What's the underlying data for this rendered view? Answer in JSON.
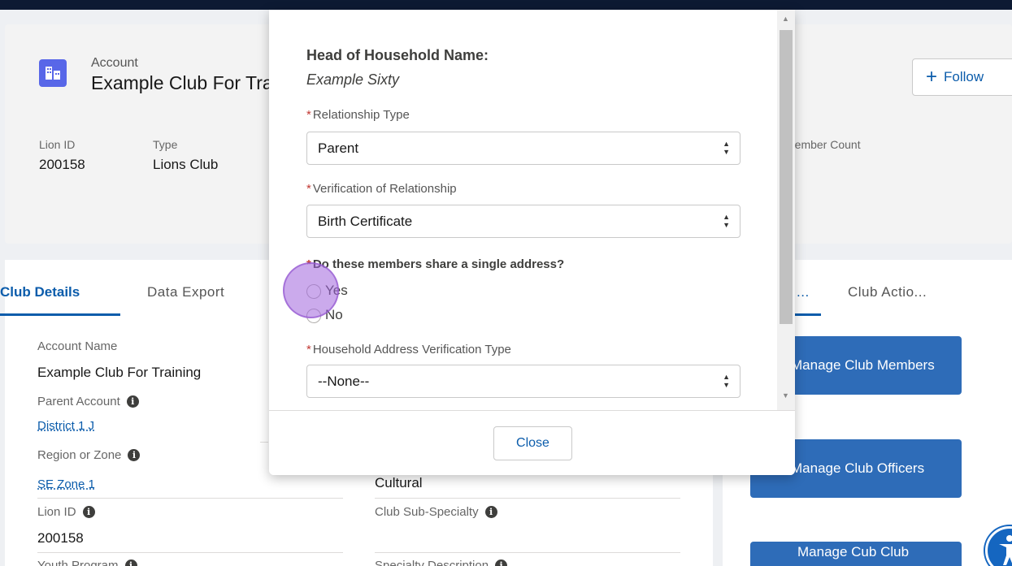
{
  "header": {
    "object_type": "Account",
    "account_name": "Example Club For Training",
    "follow_label": "Follow",
    "highlights": [
      {
        "label": "Lion ID",
        "value": "200158"
      },
      {
        "label": "Type",
        "value": "Lions Club"
      },
      {
        "label": "Member Count",
        "value": ""
      }
    ]
  },
  "tabs": {
    "left": [
      "Club Details",
      "Data Export"
    ],
    "right": [
      "...",
      "Club Actio..."
    ]
  },
  "details": {
    "account_name_label": "Account Name",
    "account_name_value": "Example Club For Training",
    "parent_account_label": "Parent Account",
    "parent_account_value": "District 1 J",
    "region_label": "Region or Zone",
    "region_value": "SE Zone 1",
    "lion_id_label": "Lion ID",
    "lion_id_value": "200158",
    "youth_label": "Youth Program",
    "specialty_value": "Cultural",
    "sub_specialty_label": "Club Sub-Specialty",
    "specialty_desc_label": "Specialty Description"
  },
  "actions": {
    "manage_members": "Manage Club Members",
    "manage_officers": "Manage Club Officers",
    "manage_cub": "Manage Cub Club"
  },
  "modal": {
    "hoh_label": "Head of Household Name:",
    "hoh_value": "Example Sixty",
    "relationship_label": "Relationship Type",
    "relationship_value": "Parent",
    "verification_label": "Verification of Relationship",
    "verification_value": "Birth Certificate",
    "address_question": "Do these members share a single address?",
    "option_yes": "Yes",
    "option_no": "No",
    "address_verification_label": "Household Address Verification Type",
    "address_verification_value": "--None--",
    "close_label": "Close"
  },
  "colors": {
    "brand_blue": "#0b5cab",
    "action_button": "#2e6cb8",
    "account_icon": "#5867e8",
    "required": "#c23934"
  }
}
